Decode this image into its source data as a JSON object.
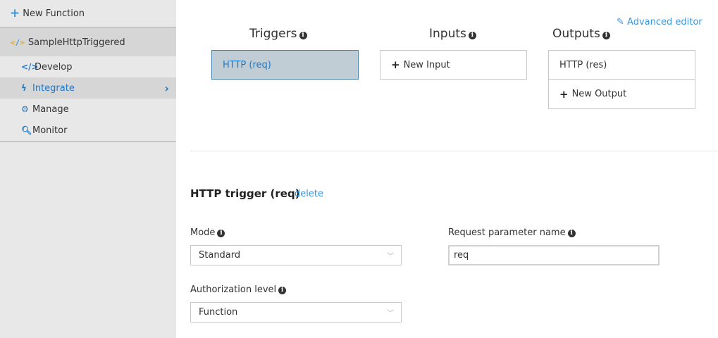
{
  "sidebar": {
    "new_function": "New Function",
    "function_name": "SampleHttpTriggered",
    "function_icon": "lightning-bracket-icon",
    "items": [
      {
        "label": "Develop",
        "icon": "code-icon"
      },
      {
        "label": "Integrate",
        "icon": "lightning-icon",
        "active": true
      },
      {
        "label": "Manage",
        "icon": "gear-icon"
      },
      {
        "label": "Monitor",
        "icon": "search-icon"
      }
    ]
  },
  "header": {
    "advanced_editor": "Advanced editor"
  },
  "columns": {
    "triggers": {
      "title": "Triggers",
      "items": [
        "HTTP (req)"
      ]
    },
    "inputs": {
      "title": "Inputs",
      "new_label": "New Input"
    },
    "outputs": {
      "title": "Outputs",
      "items": [
        "HTTP (res)"
      ],
      "new_label": "New Output"
    }
  },
  "detail": {
    "title": "HTTP trigger (req)",
    "delete_label": "delete",
    "mode": {
      "label": "Mode",
      "value": "Standard"
    },
    "auth": {
      "label": "Authorization level",
      "value": "Function"
    },
    "param": {
      "label": "Request parameter name",
      "value": "req"
    }
  },
  "colors": {
    "accent": "#3a96dd",
    "selected_bg": "#c0cdd5",
    "sidebar_bg": "#e8e8e8"
  }
}
